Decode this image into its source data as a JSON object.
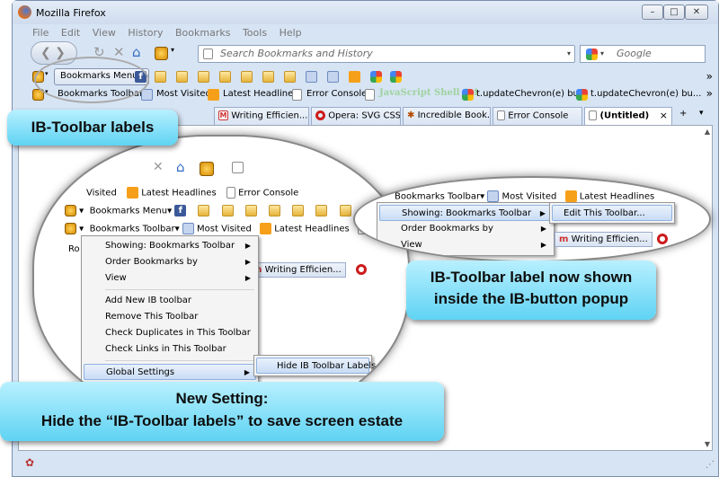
{
  "window": {
    "title": "Mozilla Firefox"
  },
  "menubar": [
    "File",
    "Edit",
    "View",
    "History",
    "Bookmarks",
    "Tools",
    "Help"
  ],
  "navbar": {
    "url_placeholder": "Search Bookmarks and History",
    "search_placeholder": "Google"
  },
  "toolbar1": {
    "menu_label": "Bookmarks Menu",
    "chevron": "»"
  },
  "toolbar2": {
    "label": "Bookmarks Toolbar",
    "items": [
      "Most Visited",
      "Latest Headlines",
      "Error Console",
      "JavaScript Shell 1.4",
      "t.updateChevron(e) bu...",
      "t.updateChevron(e) bu..."
    ],
    "chevron": "»"
  },
  "tabs": [
    "Writing Efficien...",
    "Opera: SVG CSS...",
    "Incredible Book...",
    "Error Console",
    "(Untitled)"
  ],
  "tab_close": "×",
  "callouts": {
    "c1": "IB-Toolbar labels",
    "c2": "IB-Toolbar label now shown inside the IB-button popup",
    "c3_line1": "New Setting:",
    "c3_line2": "Hide the “IB-Toolbar labels” to save screen estate"
  },
  "zoom_left": {
    "row1": [
      "Visited",
      "Latest Headlines",
      "Error Console"
    ],
    "row2_label": "Bookmarks Menu",
    "row3": [
      "Bookmarks Toolbar",
      "Most Visited",
      "Latest Headlines"
    ],
    "tab_text": "Writing Efficien...",
    "side_text": "Ro",
    "menu": [
      "Showing: Bookmarks Toolbar",
      "Order Bookmarks by",
      "View",
      "Add New IB toolbar",
      "Remove This Toolbar",
      "Check Duplicates in This Toolbar",
      "Check Links in This Toolbar",
      "Global Settings"
    ],
    "submenu": "Hide IB Toolbar Labels"
  },
  "zoom_right": {
    "row1": [
      "Bookmarks Toolbar",
      "Most Visited",
      "Latest Headlines"
    ],
    "menu": [
      "Showing: Bookmarks Toolbar",
      "Order Bookmarks by",
      "View"
    ],
    "submenu": "Edit This Toolbar...",
    "tab_text": "Writing Efficien..."
  },
  "colors": {
    "callout_top": "#b8f0ff",
    "callout_bottom": "#5fd3f3",
    "chrome": "#d7e4f4"
  }
}
